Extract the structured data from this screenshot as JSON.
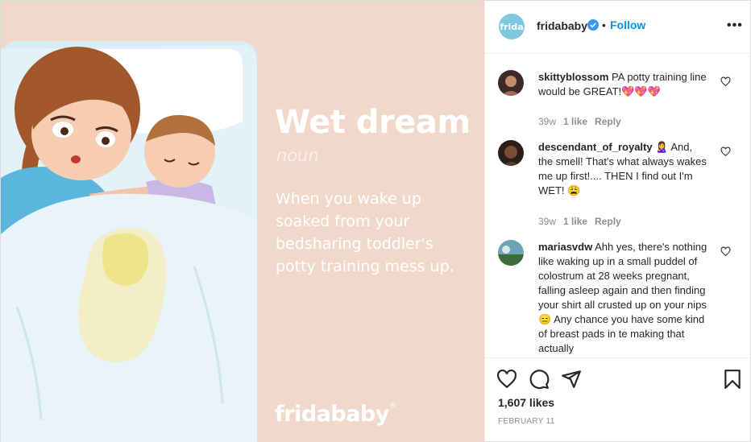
{
  "image": {
    "title": "Wet dream",
    "part_of_speech": "noun",
    "definition": "When you wake up soaked from your bedsharing toddler's potty training mess up.",
    "logo": "fridababy",
    "logo_mark": "®"
  },
  "header": {
    "avatar_text": "frida",
    "username": "fridababy",
    "separator": "•",
    "follow_label": "Follow",
    "more_label": "•••"
  },
  "comments": [
    {
      "username": "skittyblossom",
      "text": "PA potty training line would be GREAT!💖💖💖",
      "age": "39w",
      "likes": "1 like",
      "reply": "Reply"
    },
    {
      "username": "descendant_of_royalty",
      "text": "🙎‍♀️ And, the smell! That's what always wakes me up first!.... THEN I find out I'm WET! 😩",
      "age": "39w",
      "likes": "1 like",
      "reply": "Reply"
    },
    {
      "username": "mariasvdw",
      "text": "Ahh yes, there's nothing like waking up in a small puddel of colostrum at 28 weeks pregnant, falling asleep again and then finding your shirt all crusted up on your nips😑 Any chance you have some kind of breast pads in te making that actually",
      "age": "",
      "likes": "",
      "reply": ""
    }
  ],
  "likes_count": "1,607 likes",
  "post_date": "FEBRUARY 11",
  "colors": {
    "accent": "#0095f6",
    "image_bg": "#f0d8cb",
    "frida_blue": "#7ec8df"
  },
  "icons": [
    "heart-icon",
    "comment-icon",
    "share-icon",
    "bookmark-icon",
    "verified-badge-icon",
    "more-options-icon"
  ]
}
